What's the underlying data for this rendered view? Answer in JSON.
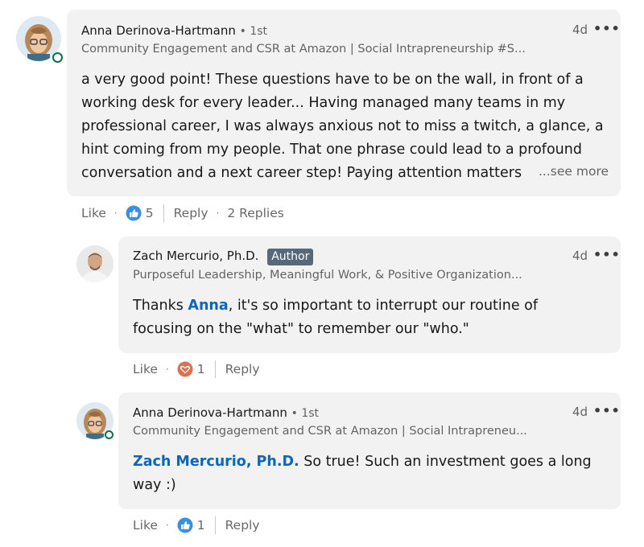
{
  "comment1": {
    "name": "Anna Derinova-Hartmann",
    "degree": "• 1st",
    "headline": "Community Engagement and CSR at Amazon | Social Intrapreneurship #S...",
    "time": "4d",
    "more_icon": "•••",
    "text": "a very good point! These questions have to be on the wall, in front of a working desk for every leader... Having managed many teams in my professional career, I was always anxious not to miss a twitch, a glance, a hint coming from my people. That one phrase could lead to a profound conversation and a next career step! Paying attention matters",
    "see_more": "...see more",
    "like_label": "Like",
    "reaction_icon": "thumbs-up-icon",
    "reaction_count": "5",
    "reply_label": "Reply",
    "replies_label": "2 Replies"
  },
  "reply1": {
    "name": "Zach Mercurio, Ph.D.",
    "badge": "Author",
    "headline": "Purposeful Leadership, Meaningful Work, & Positive Organization...",
    "time": "4d",
    "more_icon": "•••",
    "text_before": "Thanks ",
    "mention": "Anna",
    "text_after": ", it's so important to interrupt our routine of focusing on the \"what\" to remember our \"who.\"",
    "like_label": "Like",
    "reaction_icon": "heart-icon",
    "reaction_count": "1",
    "reply_label": "Reply"
  },
  "reply2": {
    "name": "Anna Derinova-Hartmann",
    "degree": "• 1st",
    "headline": "Community Engagement and CSR at Amazon | Social Intrapreneu...",
    "time": "4d",
    "more_icon": "•••",
    "mention": "Zach Mercurio, Ph.D.",
    "text_after": " So true! Such an investment goes a long way :)",
    "like_label": "Like",
    "reaction_icon": "thumbs-up-icon",
    "reaction_count": "1",
    "reply_label": "Reply"
  },
  "colors": {
    "bubble": "#f2f2f2",
    "link": "#0a66c2",
    "online": "#057642",
    "like_blue": "#378fe9",
    "love_red": "#df704d",
    "badge": "#56687a"
  }
}
